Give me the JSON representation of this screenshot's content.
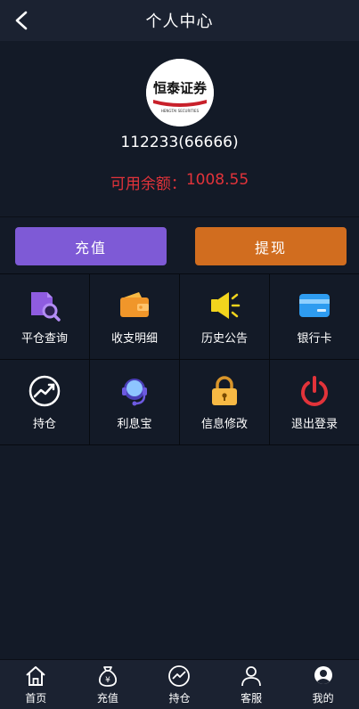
{
  "header": {
    "title": "个人中心",
    "back_icon": "chevron-left-icon"
  },
  "profile": {
    "logo_text": "恒泰证券",
    "logo_subtext": "HENGTAI SECURITIES",
    "user_id": "112233(66666)",
    "balance_label": "可用余额：",
    "balance_value": "1008.55"
  },
  "actions": {
    "recharge_label": "充值",
    "withdraw_label": "提现"
  },
  "menu": [
    {
      "label": "平仓查询",
      "icon": "search-doc-icon",
      "color": "#8f5ce0"
    },
    {
      "label": "收支明细",
      "icon": "wallet-icon",
      "color": "#f0962a"
    },
    {
      "label": "历史公告",
      "icon": "megaphone-icon",
      "color": "#f2d41d"
    },
    {
      "label": "银行卡",
      "icon": "bank-card-icon",
      "color": "#2e9cf0"
    },
    {
      "label": "持仓",
      "icon": "trend-chart-icon",
      "color": "#ffffff"
    },
    {
      "label": "利息宝",
      "icon": "headset-icon",
      "color": "#6d5ae0"
    },
    {
      "label": "信息修改",
      "icon": "lock-icon",
      "color": "#f7b944"
    },
    {
      "label": "退出登录",
      "icon": "power-icon",
      "color": "#e2333a"
    }
  ],
  "tabbar": [
    {
      "label": "首页",
      "icon": "home-icon"
    },
    {
      "label": "充值",
      "icon": "money-bag-icon"
    },
    {
      "label": "持仓",
      "icon": "chart-circle-icon"
    },
    {
      "label": "客服",
      "icon": "user-icon"
    },
    {
      "label": "我的",
      "icon": "profile-icon"
    }
  ],
  "colors": {
    "background": "#131a27",
    "header": "#1b2231",
    "recharge_button": "#7e5ad6",
    "withdraw_button": "#d16d1f",
    "balance_text": "#e2333a"
  }
}
